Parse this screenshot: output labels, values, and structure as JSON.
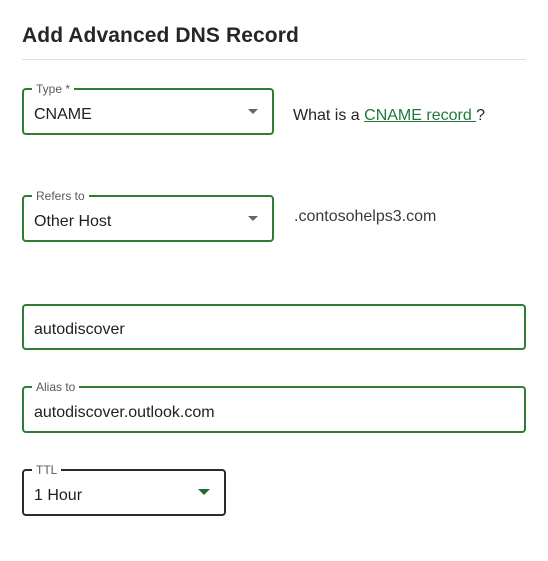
{
  "page": {
    "title": "Add Advanced DNS Record"
  },
  "type_field": {
    "legend": "Type *",
    "value": "CNAME"
  },
  "help": {
    "prefix": "What is a ",
    "link": "CNAME record ",
    "suffix": "?"
  },
  "refers_field": {
    "legend": "Refers to",
    "value": "Other Host"
  },
  "domain_suffix": ".contosohelps3.com",
  "host_field": {
    "value": "autodiscover"
  },
  "alias_field": {
    "legend": "Alias to",
    "value": "autodiscover.outlook.com"
  },
  "ttl_field": {
    "legend": "TTL",
    "value": "1 Hour"
  },
  "icons": {
    "dropdown": "chevron-down-icon"
  },
  "colors": {
    "accent": "#2e7d32",
    "link": "#1f7a3a",
    "ttl_border": "#2b2b2b"
  }
}
